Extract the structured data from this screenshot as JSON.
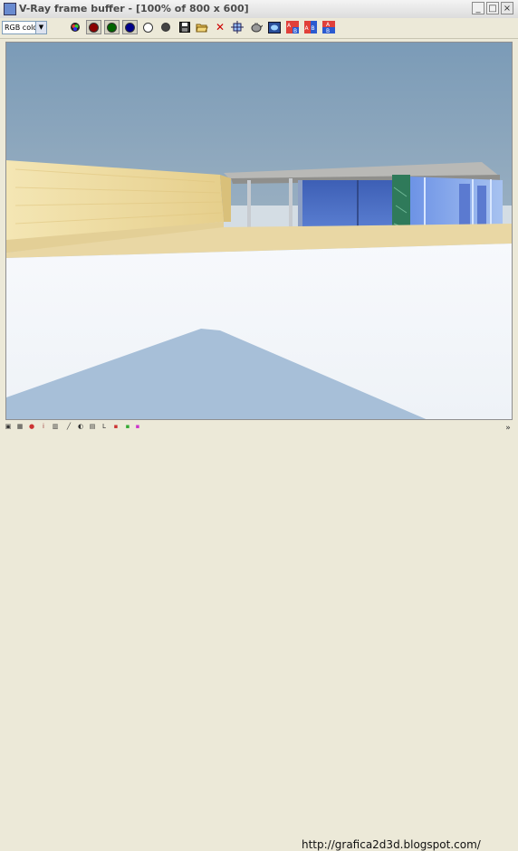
{
  "window": {
    "title": "V-Ray frame buffer - [100% of 800 x 600]"
  },
  "toolbar": {
    "channel_select": "RGB color",
    "dropdown_arrow": "▼"
  },
  "watermark": {
    "text": "http://grafica2d3d.blogspot.com/"
  },
  "colors": {
    "chrome": "#ece9d8",
    "sky_top": "#7c9cb8",
    "sky_horizon": "#c5d2dc",
    "wall": "#ecdba0",
    "glass": "#4f72c6",
    "marble": "#2f7a5a",
    "floor": "#f4f6fa",
    "pool_shadow": "#a4bdd6"
  }
}
